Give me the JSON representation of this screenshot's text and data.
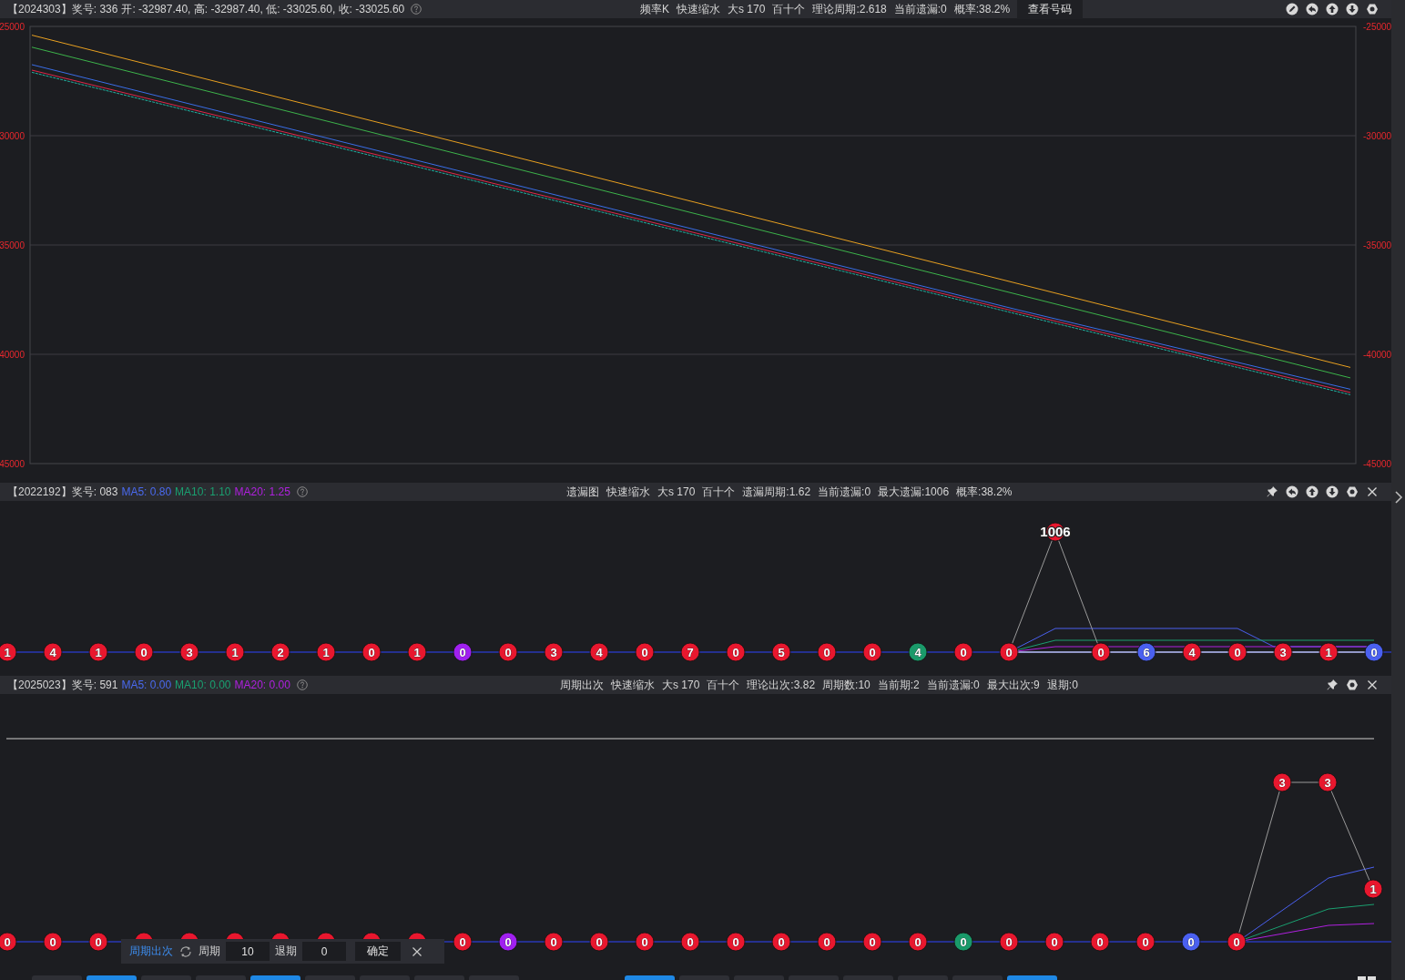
{
  "panels": [
    {
      "header": {
        "title": "【2024303】奖号: 336",
        "quote": "开: -32987.40, 高: -32987.40, 低: -33025.60, 收: -33025.60",
        "stats": [
          "频率K",
          "快速缩水",
          "大s 170",
          "百十个",
          "理论周期:2.618",
          "当前遗漏:0",
          "概率:38.2%"
        ],
        "button": "查看号码"
      },
      "left_axis_labels": [
        "25000",
        "30000",
        "35000",
        "40000",
        "45000"
      ],
      "chart_data": {
        "type": "line",
        "grid": true,
        "ylim": [
          -45000,
          -25000
        ],
        "yticks": [
          -25000,
          -30000,
          -35000,
          -40000,
          -45000
        ],
        "series": [
          {
            "color": "#e8a020",
            "line_style": "solid",
            "values": [
              -25400,
              -29200,
              -33000,
              -36800,
              -40600
            ]
          },
          {
            "color": "#3cb34a",
            "line_style": "solid",
            "values": [
              -25950,
              -29730,
              -33520,
              -37300,
              -41080
            ]
          },
          {
            "color": "#3a6ee8",
            "line_style": "solid",
            "values": [
              -26750,
              -30500,
              -34250,
              -38000,
              -41600
            ]
          },
          {
            "color": "#e0284a",
            "line_style": "solid",
            "values": [
              -27000,
              -30700,
              -34400,
              -38100,
              -41750
            ]
          },
          {
            "color": "#20b0a0",
            "line_style": "dashed",
            "values": [
              -27100,
              -30800,
              -34500,
              -38200,
              -41850
            ]
          }
        ]
      }
    },
    {
      "header": {
        "title": "【2022192】奖号: 083",
        "mas": [
          {
            "label": "MA5: 0.80",
            "color": "#4a6af0"
          },
          {
            "label": "MA10: 1.10",
            "color": "#1aa070"
          },
          {
            "label": "MA20: 1.25",
            "color": "#b020e0"
          }
        ],
        "stats": [
          "遗漏图",
          "快速缩水",
          "大s 170",
          "百十个",
          "遗漏周期:1.62",
          "当前遗漏:0",
          "最大遗漏:1006",
          "概率:38.2%"
        ]
      },
      "markers": [
        {
          "label": "1",
          "color": "#e8172e",
          "kind": "base"
        },
        {
          "label": "4",
          "color": "#e8172e",
          "kind": "base"
        },
        {
          "label": "1",
          "color": "#e8172e",
          "kind": "base"
        },
        {
          "label": "0",
          "color": "#e8172e",
          "kind": "base"
        },
        {
          "label": "3",
          "color": "#e8172e",
          "kind": "base"
        },
        {
          "label": "1",
          "color": "#e8172e",
          "kind": "base"
        },
        {
          "label": "2",
          "color": "#e8172e",
          "kind": "base"
        },
        {
          "label": "1",
          "color": "#e8172e",
          "kind": "base"
        },
        {
          "label": "0",
          "color": "#e8172e",
          "kind": "base"
        },
        {
          "label": "1",
          "color": "#e8172e",
          "kind": "base"
        },
        {
          "label": "0",
          "color": "#a020f0",
          "kind": "base"
        },
        {
          "label": "0",
          "color": "#e8172e",
          "kind": "base"
        },
        {
          "label": "3",
          "color": "#e8172e",
          "kind": "base"
        },
        {
          "label": "4",
          "color": "#e8172e",
          "kind": "base"
        },
        {
          "label": "0",
          "color": "#e8172e",
          "kind": "base"
        },
        {
          "label": "7",
          "color": "#e8172e",
          "kind": "base"
        },
        {
          "label": "0",
          "color": "#e8172e",
          "kind": "base"
        },
        {
          "label": "5",
          "color": "#e8172e",
          "kind": "base"
        },
        {
          "label": "0",
          "color": "#e8172e",
          "kind": "base"
        },
        {
          "label": "0",
          "color": "#e8172e",
          "kind": "base"
        },
        {
          "label": "4",
          "color": "#1a9a6a",
          "kind": "base"
        },
        {
          "label": "0",
          "color": "#e8172e",
          "kind": "base"
        },
        {
          "label": "0",
          "color": "#e8172e",
          "kind": "base"
        },
        {
          "label": "1006",
          "color": "#e8172e",
          "kind": "top"
        },
        {
          "label": "0",
          "color": "#e8172e",
          "kind": "base"
        },
        {
          "label": "6",
          "color": "#4a60f0",
          "kind": "base"
        },
        {
          "label": "4",
          "color": "#e8172e",
          "kind": "base"
        },
        {
          "label": "0",
          "color": "#e8172e",
          "kind": "base"
        },
        {
          "label": "3",
          "color": "#e8172e",
          "kind": "base"
        },
        {
          "label": "1",
          "color": "#e8172e",
          "kind": "base"
        },
        {
          "label": "0",
          "color": "#4a60f0",
          "kind": "base"
        }
      ]
    },
    {
      "header": {
        "title": "【2025023】奖号: 591",
        "mas": [
          {
            "label": "MA5: 0.00",
            "color": "#4a6af0"
          },
          {
            "label": "MA10: 0.00",
            "color": "#1aa070"
          },
          {
            "label": "MA20: 0.00",
            "color": "#b020e0"
          }
        ],
        "stats": [
          "周期出次",
          "快速缩水",
          "大s 170",
          "百十个",
          "理论出次:3.82",
          "周期数:10",
          "当前期:2",
          "当前遗漏:0",
          "最大出次:9",
          "退期:0"
        ]
      },
      "markers": [
        {
          "label": "0",
          "color": "#e8172e",
          "kind": "base"
        },
        {
          "label": "0",
          "color": "#e8172e",
          "kind": "base"
        },
        {
          "label": "0",
          "color": "#e8172e",
          "kind": "base"
        },
        {
          "color": "#e8172e",
          "kind": "base"
        },
        {
          "color": "#e8172e",
          "kind": "base"
        },
        {
          "color": "#e8172e",
          "kind": "base"
        },
        {
          "color": "#e8172e",
          "kind": "base"
        },
        {
          "color": "#e8172e",
          "kind": "base"
        },
        {
          "color": "#e8172e",
          "kind": "base"
        },
        {
          "color": "#e8172e",
          "kind": "base"
        },
        {
          "label": "0",
          "color": "#e8172e",
          "kind": "base"
        },
        {
          "label": "0",
          "color": "#a020f0",
          "kind": "base"
        },
        {
          "label": "0",
          "color": "#e8172e",
          "kind": "base"
        },
        {
          "label": "0",
          "color": "#e8172e",
          "kind": "base"
        },
        {
          "label": "0",
          "color": "#e8172e",
          "kind": "base"
        },
        {
          "label": "0",
          "color": "#e8172e",
          "kind": "base"
        },
        {
          "label": "0",
          "color": "#e8172e",
          "kind": "base"
        },
        {
          "label": "0",
          "color": "#e8172e",
          "kind": "base"
        },
        {
          "label": "0",
          "color": "#e8172e",
          "kind": "base"
        },
        {
          "label": "0",
          "color": "#e8172e",
          "kind": "base"
        },
        {
          "label": "0",
          "color": "#e8172e",
          "kind": "base"
        },
        {
          "label": "0",
          "color": "#1a9a6a",
          "kind": "base"
        },
        {
          "label": "0",
          "color": "#e8172e",
          "kind": "base"
        },
        {
          "label": "0",
          "color": "#e8172e",
          "kind": "base"
        },
        {
          "label": "0",
          "color": "#e8172e",
          "kind": "base"
        },
        {
          "label": "0",
          "color": "#e8172e",
          "kind": "base"
        },
        {
          "label": "0",
          "color": "#4a60f0",
          "kind": "base"
        },
        {
          "label": "0",
          "color": "#e8172e",
          "kind": "base"
        },
        {
          "label": "3",
          "color": "#e8172e",
          "kind": "top"
        },
        {
          "label": "3",
          "color": "#e8172e",
          "kind": "top"
        },
        {
          "label": "1",
          "color": "#e8172e",
          "kind": "mid"
        }
      ],
      "toolbar": {
        "mode": "周期出次",
        "period_label": "周期",
        "period": "10",
        "back_label": "退期",
        "back": "0",
        "confirm": "确定"
      }
    }
  ],
  "bottom_tabs": [
    {
      "selected": false
    },
    {
      "selected": true
    },
    {
      "selected": false
    },
    {
      "selected": false
    },
    {
      "selected": true
    },
    {
      "selected": false
    },
    {
      "selected": false
    },
    {
      "selected": false
    },
    {
      "selected": false
    },
    {
      "selected": true
    },
    {
      "selected": false
    },
    {
      "selected": false
    },
    {
      "selected": false
    },
    {
      "selected": false
    },
    {
      "selected": false
    },
    {
      "selected": false
    },
    {
      "selected": true
    }
  ]
}
